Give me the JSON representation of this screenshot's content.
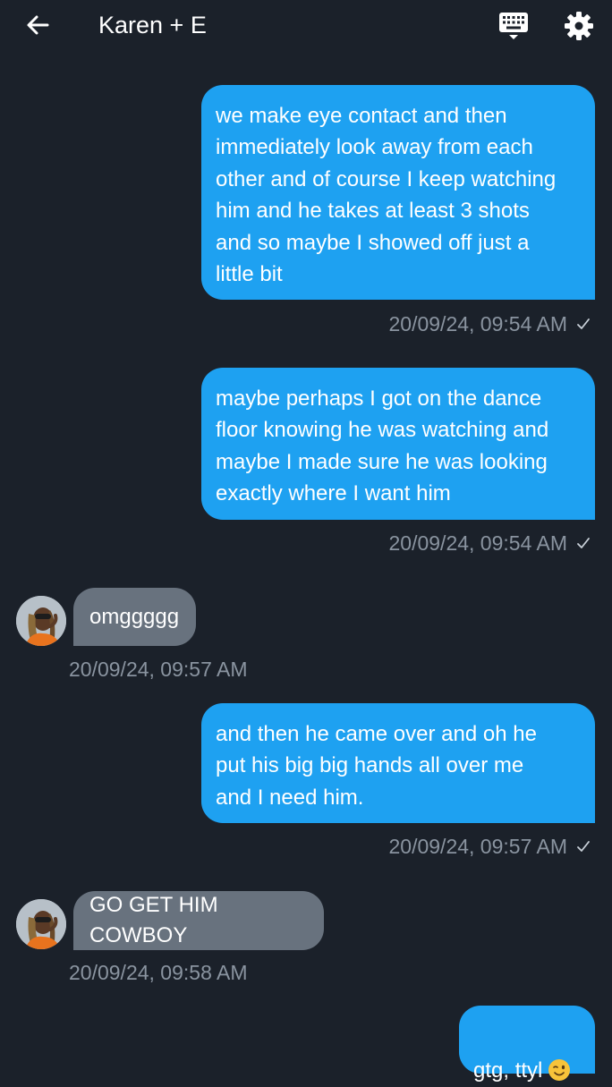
{
  "header": {
    "title": "Karen + E"
  },
  "messages": [
    {
      "direction": "outgoing",
      "text": "we make eye contact and then\nimmediately look away from each\nother and of course I keep watching\nhim and he takes at least 3 shots\nand so maybe I showed off just a\nlittle bit",
      "timestamp": "20/09/24, 09:54 AM",
      "status": "sent"
    },
    {
      "direction": "outgoing",
      "text": "maybe perhaps I got on the dance\nfloor knowing he was watching and\nmaybe I made sure he was looking\nexactly where I want him",
      "timestamp": "20/09/24, 09:54 AM",
      "status": "sent"
    },
    {
      "direction": "incoming",
      "text": "omggggg",
      "timestamp": "20/09/24, 09:57 AM"
    },
    {
      "direction": "outgoing",
      "text": "and then he came over and oh he\nput his big big hands all over me\nand I need him.",
      "timestamp": "20/09/24, 09:57 AM",
      "status": "sent"
    },
    {
      "direction": "incoming",
      "text": "GO GET HIM COWBOY",
      "timestamp": "20/09/24, 09:58 AM"
    },
    {
      "direction": "outgoing",
      "text": "gtg, ttyl",
      "emoji": "winking-face"
    }
  ],
  "icons": {
    "back": "arrow-left-icon",
    "keyboard": "keyboard-icon",
    "settings": "gear-icon",
    "read_status": "check-icon"
  },
  "colors": {
    "background": "#1b212a",
    "outgoing_bubble": "#1ea1f1",
    "incoming_bubble": "#68727e",
    "timestamp": "#8a94a0"
  }
}
